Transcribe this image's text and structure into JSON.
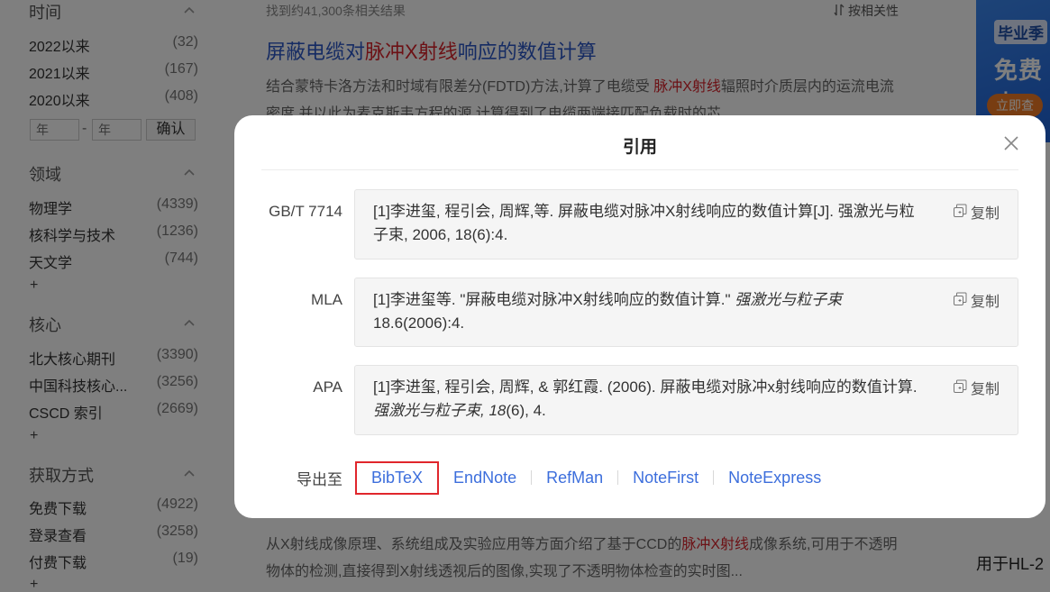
{
  "sidebar": {
    "sections": [
      {
        "title": "时间",
        "icon": "chevron-up-icon",
        "items": [
          {
            "label": "2022以来",
            "count": "(32)"
          },
          {
            "label": "2021以来",
            "count": "(167)"
          },
          {
            "label": "2020以来",
            "count": "(408)"
          }
        ],
        "year_from_placeholder": "年",
        "year_to_placeholder": "年",
        "dash": "-",
        "confirm": "确认"
      },
      {
        "title": "领域",
        "icon": "chevron-up-icon",
        "items": [
          {
            "label": "物理学",
            "count": "(4339)"
          },
          {
            "label": "核科学与技术",
            "count": "(1236)"
          },
          {
            "label": "天文学",
            "count": "(744)"
          }
        ],
        "more": "+"
      },
      {
        "title": "核心",
        "icon": "chevron-up-icon",
        "items": [
          {
            "label": "北大核心期刊",
            "count": "(3390)"
          },
          {
            "label": "中国科技核心...",
            "count": "(3256)"
          },
          {
            "label": "CSCD 索引",
            "count": "(2669)"
          }
        ],
        "more": "+"
      },
      {
        "title": "获取方式",
        "icon": "chevron-up-icon",
        "items": [
          {
            "label": "免费下载",
            "count": "(4922)"
          },
          {
            "label": "登录查看",
            "count": "(3258)"
          },
          {
            "label": "付费下载",
            "count": "(19)"
          }
        ],
        "more": "+"
      }
    ]
  },
  "results": {
    "count_text": "找到约41,300条相关结果",
    "sort_label": "按相关性",
    "first": {
      "title_pre": "屏蔽电缆对",
      "title_hl": "脉冲X射线",
      "title_post": "响应的数值计算",
      "abstract_pre": "结合蒙特卡洛方法和时域有限差分(FDTD)方法,计算了电缆受 ",
      "abstract_hl": "脉冲X射线",
      "abstract_post": "辐照时介质层内的运流电流",
      "abstract_line2": "密度,并以此为麦克斯韦方程的源,计算得到了电缆两端接匹配负载时的芯..."
    },
    "second": {
      "abstract_pre": "从X射线成像原理、系统组成及实验应用等方面介绍了基于CCD的",
      "abstract_hl": "脉冲X射线",
      "abstract_post": "成像系统,可用于不透明",
      "abstract_line2": "物体的检测,直接得到X射线透视后的图像,实现了不透明物体检查的实时图..."
    }
  },
  "ad": {
    "line1": "毕业季",
    "line2": "免费查",
    "line3": "立即查"
  },
  "right_fragment": "用于HL-2",
  "modal": {
    "title": "引用",
    "copy_label": "复制",
    "citations": [
      {
        "format": "GB/T 7714",
        "text": "[1]李进玺, 程引会, 周辉,等. 屏蔽电缆对脉冲X射线响应的数值计算[J]. 强激光与粒子束, 2006, 18(6):4."
      },
      {
        "format": "MLA",
        "text_pre": "[1]李进玺等. \"屏蔽电缆对脉冲X射线响应的数值计算.\" ",
        "text_italic": "强激光与粒子束",
        "text_post": " 18.6(2006):4."
      },
      {
        "format": "APA",
        "text_pre": "[1]李进玺, 程引会, 周辉, & 郭红霞. (2006). 屏蔽电缆对脉冲x射线响应的数值计算. ",
        "text_italic": "强激光与粒子束, 18",
        "text_post": "(6), 4."
      }
    ],
    "export_label": "导出至",
    "export_options": [
      "BibTeX",
      "EndNote",
      "RefMan",
      "NoteFirst",
      "NoteExpress"
    ],
    "highlighted_option": "BibTeX",
    "highlight_color": "#e0262c",
    "link_color": "#3c6edc"
  }
}
